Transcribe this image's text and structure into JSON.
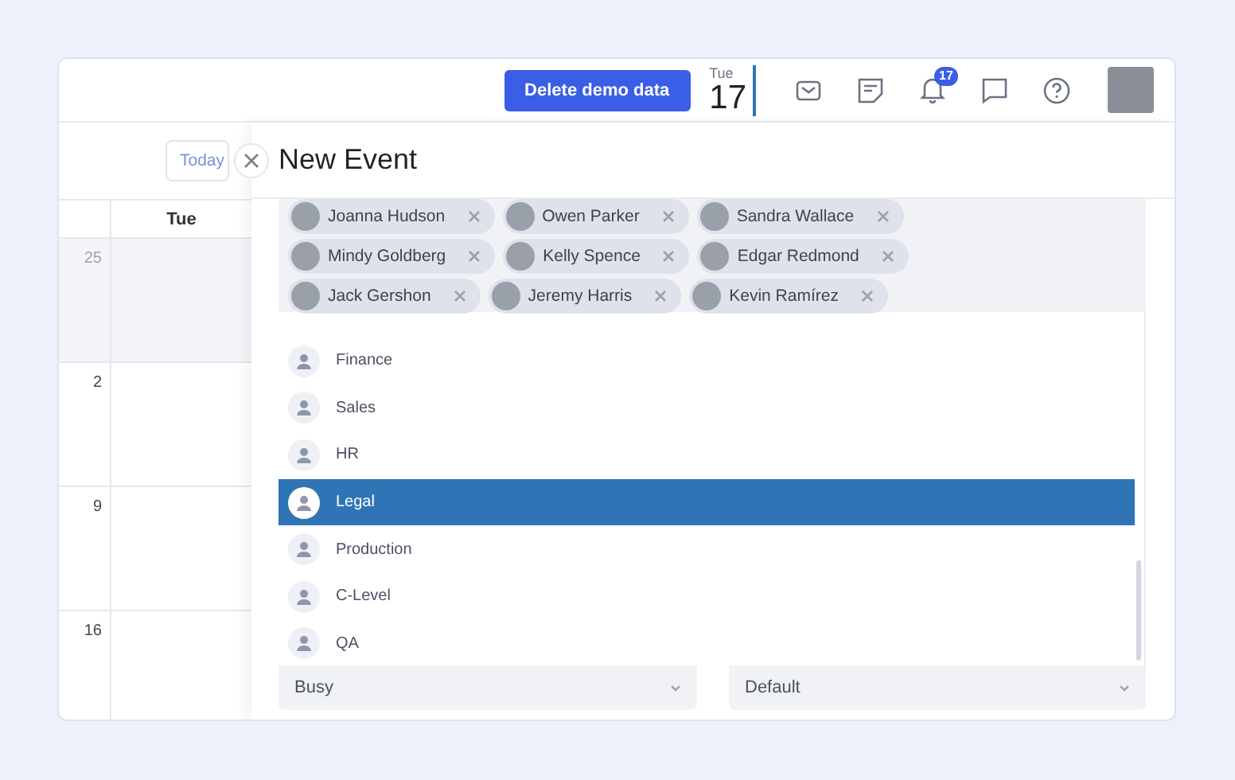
{
  "header": {
    "delete_button": "Delete demo data",
    "date": {
      "weekday": "Tue",
      "day": "17"
    },
    "notification_count": "17"
  },
  "calendar": {
    "today_button": "Today",
    "column": "Tue",
    "weeks": [
      {
        "day": "25",
        "outside_month": true
      },
      {
        "day": "2",
        "outside_month": false
      },
      {
        "day": "9",
        "outside_month": false
      },
      {
        "day": "16",
        "outside_month": false
      }
    ]
  },
  "new_event": {
    "title": "New Event",
    "attendees": [
      {
        "name": "Joanna Hudson"
      },
      {
        "name": "Owen Parker"
      },
      {
        "name": "Sandra Wallace"
      },
      {
        "name": "Mindy Goldberg"
      },
      {
        "name": "Kelly Spence"
      },
      {
        "name": "Edgar Redmond"
      },
      {
        "name": "Jack Gershon"
      },
      {
        "name": "Jeremy Harris"
      },
      {
        "name": "Kevin Ramírez"
      }
    ],
    "groups": [
      {
        "label": "Finance",
        "selected": false
      },
      {
        "label": "Sales",
        "selected": false
      },
      {
        "label": "HR",
        "selected": false
      },
      {
        "label": "Legal",
        "selected": true
      },
      {
        "label": "Production",
        "selected": false
      },
      {
        "label": "C-Level",
        "selected": false
      },
      {
        "label": "QA",
        "selected": false
      }
    ],
    "show_as": "Busy",
    "reminder": "Default"
  }
}
